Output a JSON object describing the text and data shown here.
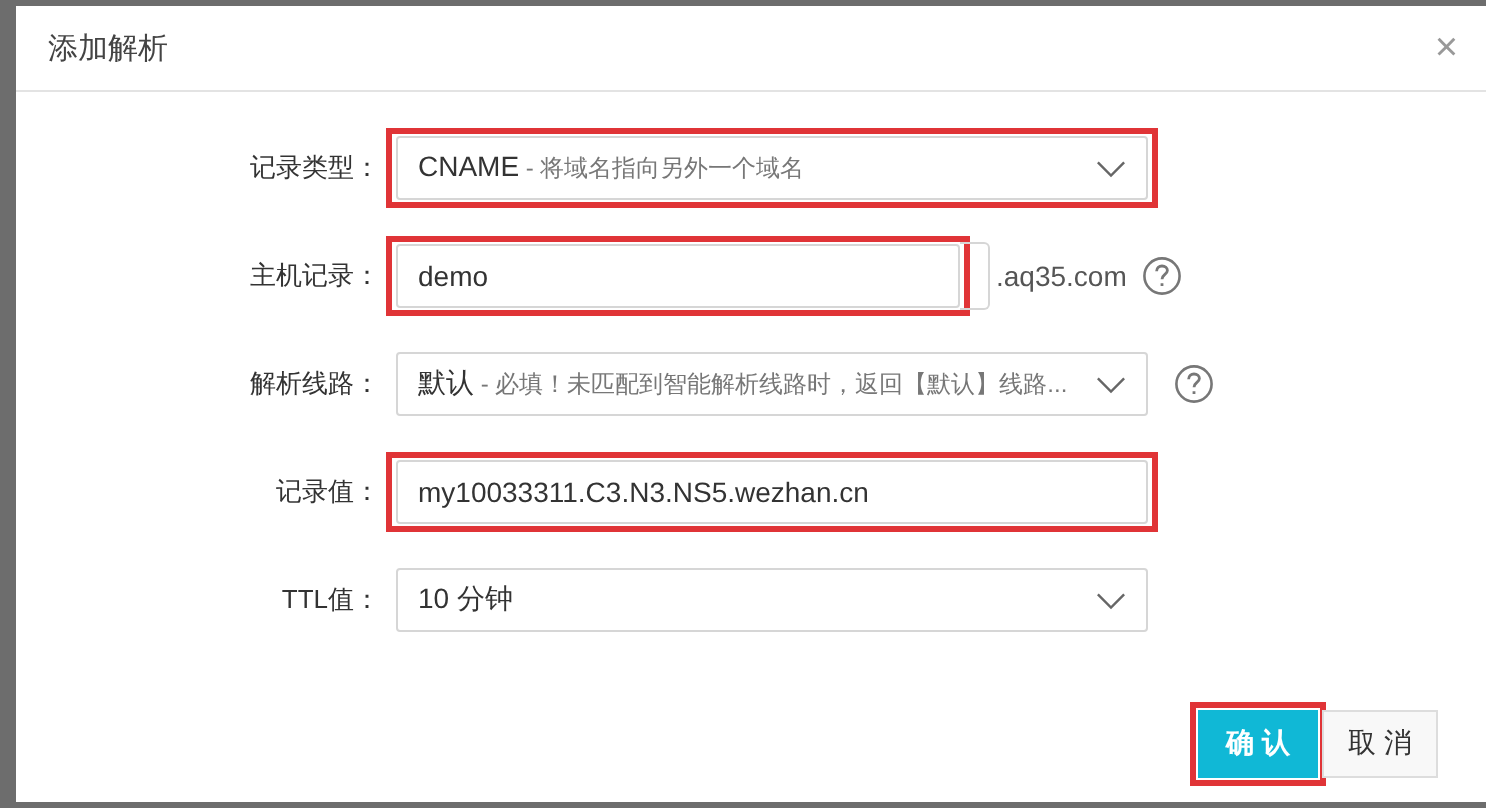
{
  "dialog": {
    "title": "添加解析",
    "close": "×"
  },
  "rows": [
    {
      "kind": "select",
      "label": "记录类型：",
      "value": "CNAME",
      "hint": " - 将域名指向另外一个域名",
      "help": false,
      "highlighted": true
    },
    {
      "kind": "input",
      "label": "主机记录：",
      "value": "demo",
      "suffix": ".aq35.com",
      "help": true,
      "highlighted": true
    },
    {
      "kind": "select",
      "label": "解析线路：",
      "value": "默认",
      "hint": " - 必填！未匹配到智能解析线路时，返回【默认】线路...",
      "help": true,
      "highlighted": false
    },
    {
      "kind": "input",
      "label": "记录值：",
      "value": "my10033311.C3.N3.NS5.wezhan.cn",
      "help": false,
      "highlighted": true
    },
    {
      "kind": "select",
      "label": "TTL值：",
      "value": "10 分钟",
      "help": false,
      "highlighted": false
    }
  ],
  "buttons": [
    {
      "kind": "primary",
      "label": "确 认",
      "highlighted": true
    },
    {
      "kind": "secondary",
      "label": "取 消",
      "highlighted": false
    }
  ]
}
